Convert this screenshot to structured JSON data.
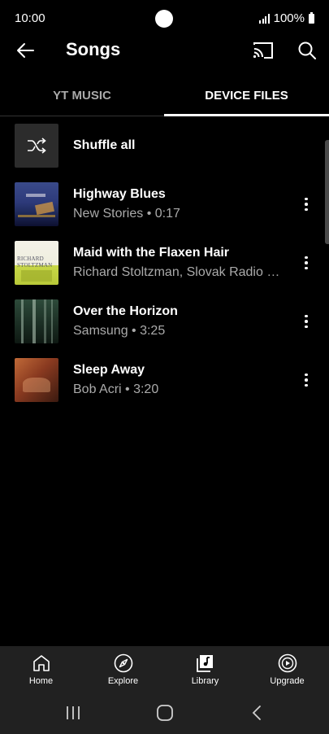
{
  "status": {
    "time": "10:00",
    "battery": "100%"
  },
  "header": {
    "title": "Songs"
  },
  "tabs": [
    {
      "label": "YT MUSIC",
      "active": false
    },
    {
      "label": "DEVICE FILES",
      "active": true
    }
  ],
  "shuffle": {
    "label": "Shuffle all"
  },
  "songs": [
    {
      "title": "Highway Blues",
      "subtitle": "New Stories • 0:17",
      "art": "highway-blues-cover"
    },
    {
      "title": "Maid with the Flaxen Hair",
      "subtitle": "Richard Stoltzman, Slovak Radio Sy...",
      "art": "richard-stoltzman-cover",
      "art_text": "RICHARD STOLTZMAN"
    },
    {
      "title": "Over the Horizon",
      "subtitle": "Samsung • 3:25",
      "art": "forest-cover"
    },
    {
      "title": "Sleep Away",
      "subtitle": "Bob Acri • 3:20",
      "art": "sleep-away-cover"
    }
  ],
  "bottom_nav": [
    {
      "label": "Home",
      "icon": "home-icon"
    },
    {
      "label": "Explore",
      "icon": "compass-icon"
    },
    {
      "label": "Library",
      "icon": "library-icon",
      "active": true
    },
    {
      "label": "Upgrade",
      "icon": "play-circle-icon"
    }
  ],
  "colors": {
    "background": "#000000",
    "nav_background": "#212121",
    "secondary_text": "#aaaaaa"
  }
}
